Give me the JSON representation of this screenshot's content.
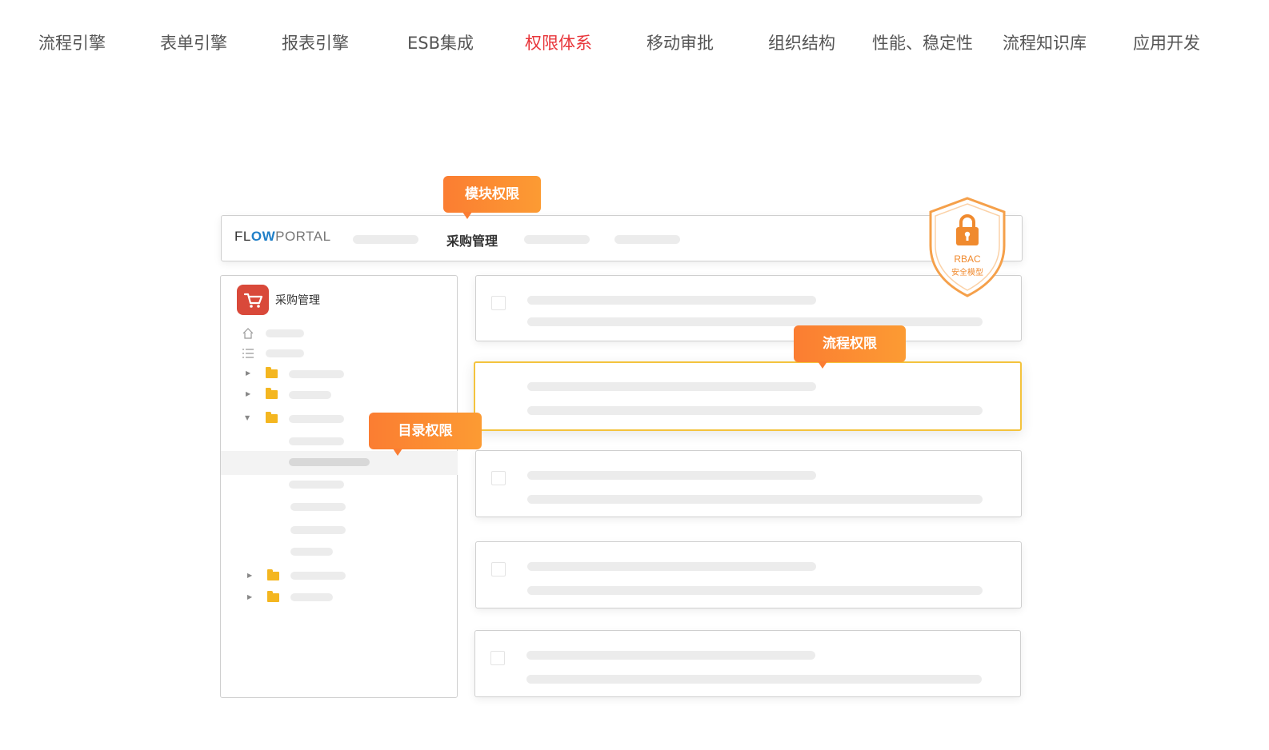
{
  "nav": {
    "items": [
      {
        "label": "流程引擎"
      },
      {
        "label": "表单引擎"
      },
      {
        "label": "报表引擎"
      },
      {
        "label": "ESB集成"
      },
      {
        "label": "权限体系"
      },
      {
        "label": "移动审批"
      },
      {
        "label": "组织结构"
      },
      {
        "label": "性能、稳定性"
      },
      {
        "label": "流程知识库"
      },
      {
        "label": "应用开发"
      }
    ],
    "active_label": "权限体系",
    "active_color": "#e8353a"
  },
  "illustration": {
    "logo": {
      "part1": "FL",
      "part2": "OW",
      "part3": "PORTAL"
    },
    "header_title": "采购管理",
    "sidebar_app_name": "采购管理",
    "tags": {
      "module": "模块权限",
      "process": "流程权限",
      "catalog": "目录权限"
    },
    "shield": {
      "line1": "RBAC",
      "line2": "安全模型",
      "icon": "lock-icon"
    },
    "colors": {
      "tag_orange": "#fb7d32",
      "highlight_border": "#f4c33d",
      "app_icon_red": "#d9493a",
      "folder_yellow": "#f4b620",
      "shield_orange": "#f08a2e"
    }
  }
}
